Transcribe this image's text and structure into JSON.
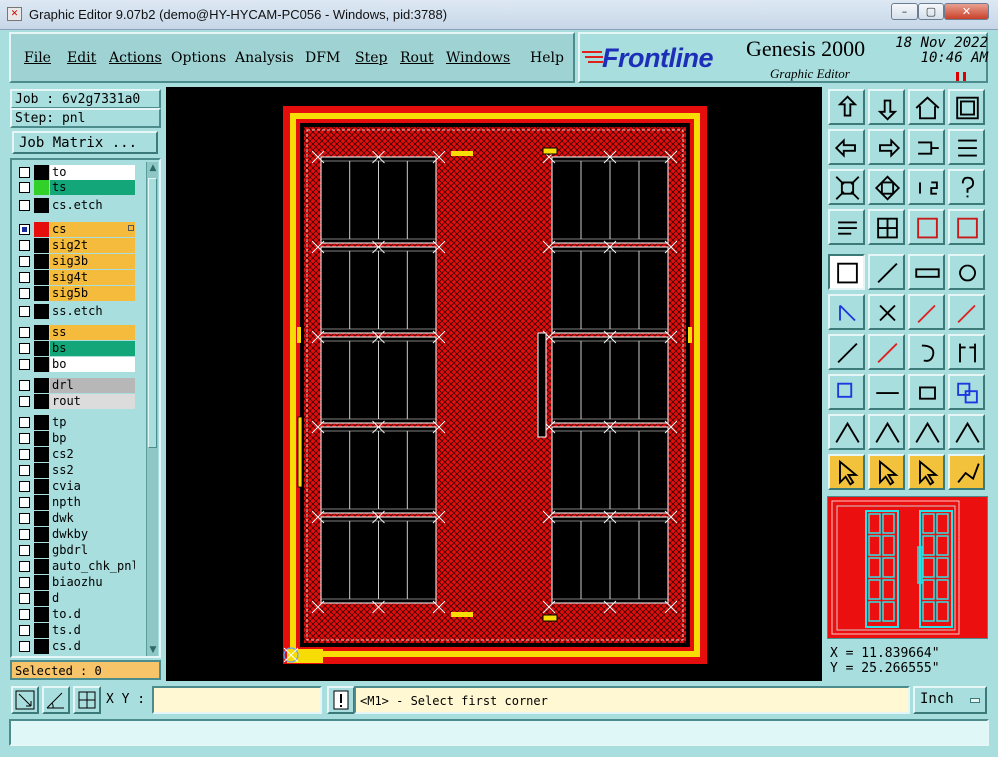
{
  "window": {
    "title": "Graphic Editor 9.07b2 (demo@HY-HYCAM-PC056 - Windows, pid:3788)",
    "controls": [
      "minimize",
      "maximize",
      "close"
    ]
  },
  "menu": {
    "items": [
      {
        "id": "file",
        "label": "File"
      },
      {
        "id": "edit",
        "label": "Edit"
      },
      {
        "id": "actions",
        "label": "Actions"
      },
      {
        "id": "options",
        "label": "Options"
      },
      {
        "id": "analysis",
        "label": "Analysis"
      },
      {
        "id": "dfm",
        "label": "DFM"
      },
      {
        "id": "step",
        "label": "Step"
      },
      {
        "id": "rout",
        "label": "Rout"
      },
      {
        "id": "windows",
        "label": "Windows"
      },
      {
        "id": "help",
        "label": "Help"
      }
    ]
  },
  "brand": {
    "logo": "Frontline",
    "product": "Genesis 2000",
    "subtitle": "Graphic Editor",
    "date": "18 Nov 2022",
    "time": "10:46 AM"
  },
  "job": {
    "job_text": "Job : 6v2g7331a0",
    "step_text": "Step: pnl",
    "matrix_button": "Job Matrix ..."
  },
  "layers": [
    {
      "name": "to",
      "bg": "#ffffff",
      "swatch": "#000000"
    },
    {
      "name": "ts",
      "bg": "#12a679",
      "swatch": "#31d12a"
    },
    {
      "name": "cs.etch",
      "bg": "#a9dede",
      "swatch": "#000000"
    },
    {
      "name": "cs",
      "bg": "#f5bb3c",
      "swatch": "#e60d0d",
      "checked": true,
      "affected": true
    },
    {
      "name": "sig2t",
      "bg": "#f5bb3c",
      "swatch": "#000000"
    },
    {
      "name": "sig3b",
      "bg": "#f5bb3c",
      "swatch": "#000000"
    },
    {
      "name": "sig4t",
      "bg": "#f5bb3c",
      "swatch": "#000000"
    },
    {
      "name": "sig5b",
      "bg": "#f5bb3c",
      "swatch": "#000000"
    },
    {
      "name": "ss.etch",
      "bg": "#a9dede",
      "swatch": "#000000"
    },
    {
      "name": "ss",
      "bg": "#f5bb3c",
      "swatch": "#000000"
    },
    {
      "name": "bs",
      "bg": "#12a679",
      "swatch": "#000000"
    },
    {
      "name": "bo",
      "bg": "#ffffff",
      "swatch": "#000000"
    },
    {
      "name": "drl",
      "bg": "#b7b7b7",
      "swatch": "#000000"
    },
    {
      "name": "rout",
      "bg": "#dcdcdc",
      "swatch": "#000000"
    },
    {
      "name": "tp",
      "bg": "#a9dede",
      "swatch": "#000000"
    },
    {
      "name": "bp",
      "bg": "#a9dede",
      "swatch": "#000000"
    },
    {
      "name": "cs2",
      "bg": "#a9dede",
      "swatch": "#000000"
    },
    {
      "name": "ss2",
      "bg": "#a9dede",
      "swatch": "#000000"
    },
    {
      "name": "cvia",
      "bg": "#a9dede",
      "swatch": "#000000"
    },
    {
      "name": "npth",
      "bg": "#a9dede",
      "swatch": "#000000"
    },
    {
      "name": "dwk",
      "bg": "#a9dede",
      "swatch": "#000000"
    },
    {
      "name": "dwkby",
      "bg": "#a9dede",
      "swatch": "#000000"
    },
    {
      "name": "gbdrl",
      "bg": "#a9dede",
      "swatch": "#000000"
    },
    {
      "name": "auto_chk_pnl",
      "bg": "#a9dede",
      "swatch": "#000000"
    },
    {
      "name": "biaozhu",
      "bg": "#a9dede",
      "swatch": "#000000"
    },
    {
      "name": "d",
      "bg": "#a9dede",
      "swatch": "#000000"
    },
    {
      "name": "to.d",
      "bg": "#a9dede",
      "swatch": "#000000"
    },
    {
      "name": "ts.d",
      "bg": "#a9dede",
      "swatch": "#000000"
    },
    {
      "name": "cs.d",
      "bg": "#a9dede",
      "swatch": "#000000"
    }
  ],
  "selected_text": "Selected : 0",
  "coords": {
    "x_text": "X = 11.839664\"",
    "y_text": "Y = 25.266555\""
  },
  "bottom": {
    "xy_label": "X Y :",
    "xy_value": "",
    "message": "<M1> - Select first corner",
    "units": "Inch"
  },
  "colors": {
    "panel": "#a9dede",
    "canvas": "#000000",
    "board_red": "#e60d0d",
    "border_yellow": "#f7dc05",
    "affected_layer": "#f5bb3c"
  }
}
